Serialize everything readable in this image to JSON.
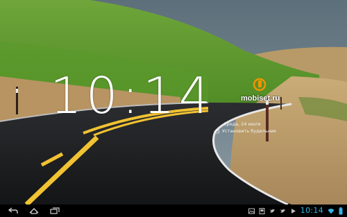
{
  "lockscreen": {
    "clock": "10:14",
    "date": "Среда, 24 июля",
    "alarm_label": "Установить будильник"
  },
  "watermark": {
    "text": "mobiset.ru"
  },
  "statusbar": {
    "time": "10:14",
    "notification_icons": [
      "gallery-icon",
      "screenshot-icon",
      "twitter-icon",
      "twitter-icon",
      "media-icon",
      "wifi-icon",
      "battery-icon"
    ]
  },
  "colors": {
    "clock_accent": "#33b5e5",
    "watermark_accent": "#f29400"
  }
}
